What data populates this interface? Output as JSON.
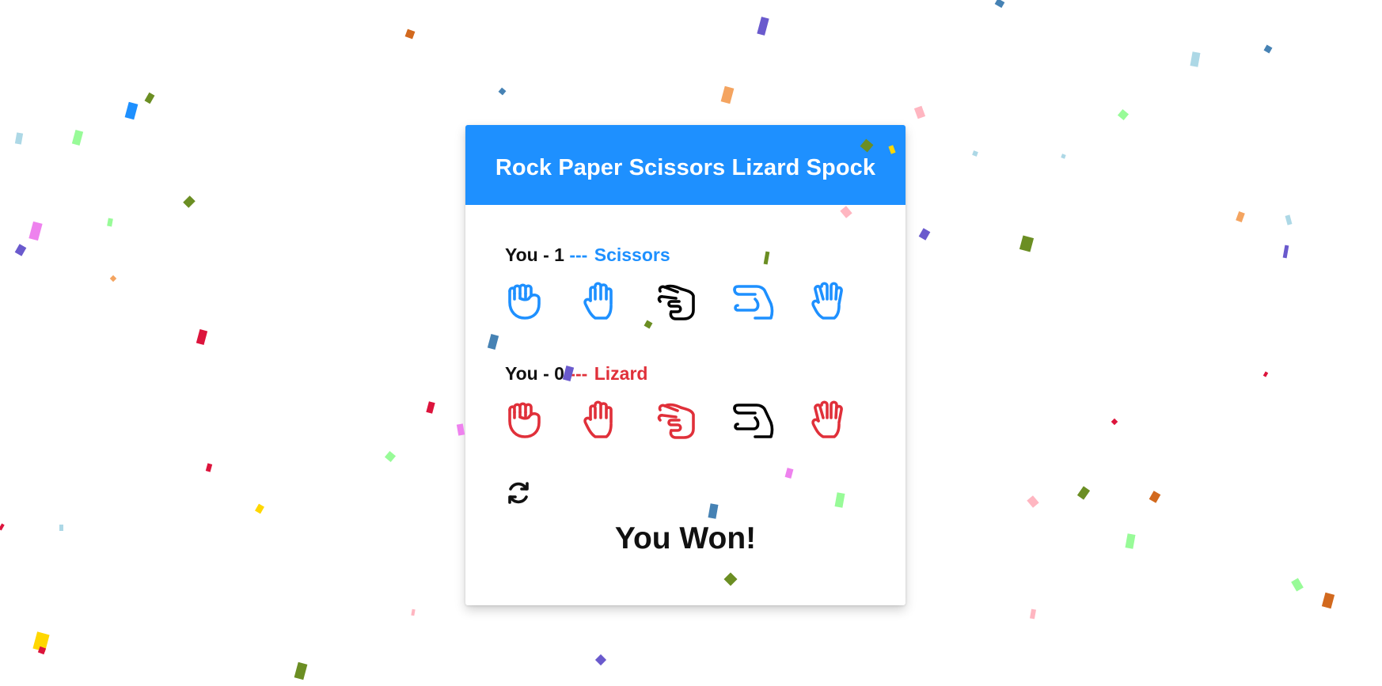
{
  "header": {
    "title": "Rock Paper Scissors Lizard Spock"
  },
  "player": {
    "label": "You - 1",
    "separator": "---",
    "choice": "Scissors",
    "color": "#1e90ff",
    "icons": [
      "rock-icon",
      "paper-icon",
      "scissors-icon",
      "lizard-icon",
      "spock-icon"
    ],
    "selected": "scissors-icon"
  },
  "computer": {
    "label": "You - 0",
    "separator": "---",
    "choice": "Lizard",
    "color": "#e0303a",
    "icons": [
      "rock-icon",
      "paper-icon",
      "scissors-icon",
      "lizard-icon",
      "spock-icon"
    ],
    "selected": "lizard-icon"
  },
  "reset": {
    "icon": "refresh-icon"
  },
  "result": {
    "text": "You Won!"
  },
  "colors": {
    "header_bg": "#1e90ff",
    "selected_icon": "#000000"
  }
}
